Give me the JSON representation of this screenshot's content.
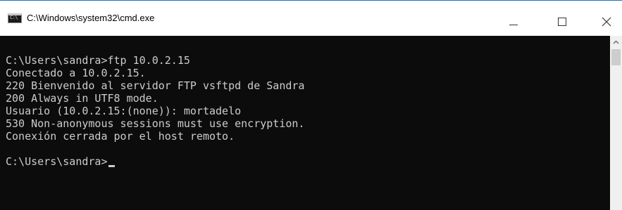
{
  "window": {
    "title": "C:\\Windows\\system32\\cmd.exe",
    "icon_label": "C:\\"
  },
  "titlebar_buttons": {
    "minimize": "—",
    "maximize": "☐",
    "close": "✕"
  },
  "console": {
    "lines": [
      "C:\\Users\\sandra>ftp 10.0.2.15",
      "Conectado a 10.0.2.15.",
      "220 Bienvenido al servidor FTP vsftpd de Sandra",
      "200 Always in UTF8 mode.",
      "Usuario (10.0.2.15:(none)): mortadelo",
      "530 Non-anonymous sessions must use encryption.",
      "Conexión cerrada por el host remoto.",
      "",
      "C:\\Users\\sandra>"
    ]
  },
  "colors": {
    "console_bg": "#0c0c0c",
    "console_text": "#cccccc",
    "titlebar_bg": "#ffffff"
  }
}
